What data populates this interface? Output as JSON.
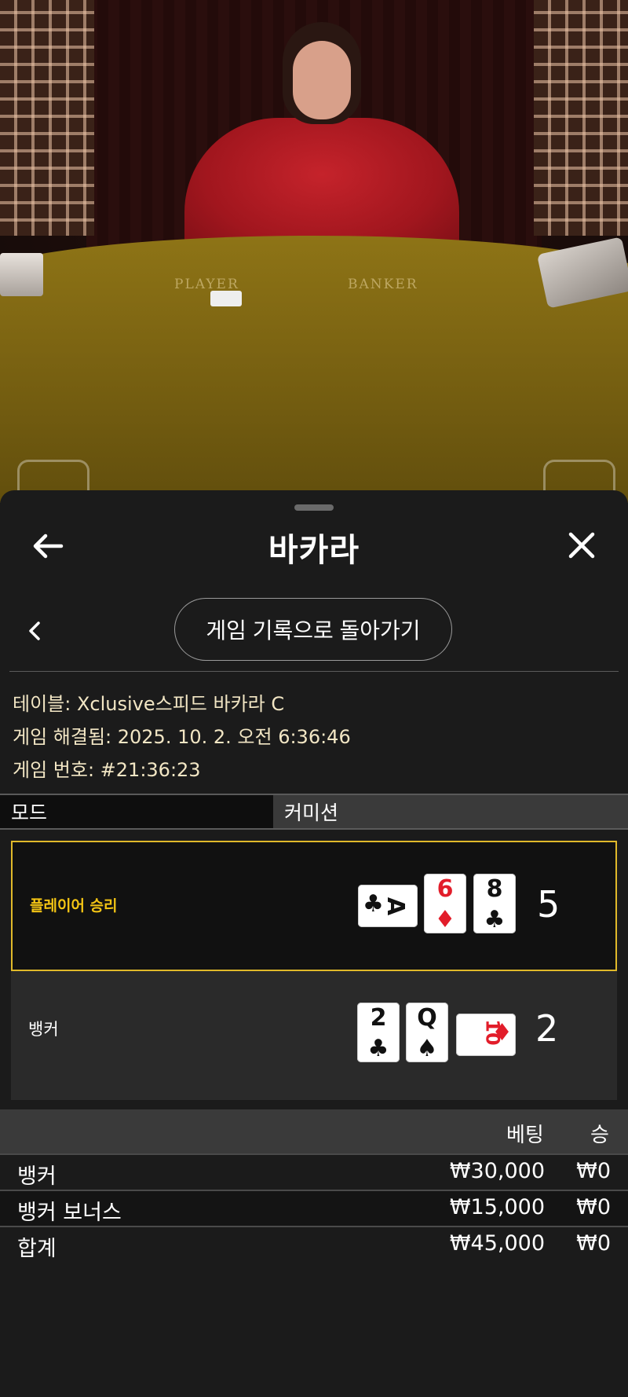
{
  "video": {
    "felt_player": "PLAYER",
    "felt_banker": "BANKER"
  },
  "header": {
    "title": "바카라",
    "back_icon": "arrow-left-icon",
    "close_icon": "close-icon"
  },
  "nav": {
    "history_button": "게임 기록으로 돌아가기",
    "chevron_icon": "chevron-left-icon"
  },
  "info": {
    "table_label": "테이블: ",
    "table_value": "Xclusive스피드 바카라 C",
    "resolved_label": "게임 해결됨: ",
    "resolved_value": "2025. 10. 2. 오전 6:36:46",
    "number_label": "게임 번호: ",
    "number_value": "#21:36:23"
  },
  "tabs": {
    "mode": "모드",
    "commission": "커미션"
  },
  "results": {
    "player": {
      "label": "플레이어 승리",
      "score": "5",
      "cards": [
        {
          "rank": "A",
          "suit": "♣",
          "color": "#111111",
          "orientation": "sideways"
        },
        {
          "rank": "6",
          "suit": "♦",
          "color": "#e21d2a",
          "orientation": "upright"
        },
        {
          "rank": "8",
          "suit": "♣",
          "color": "#111111",
          "orientation": "upright"
        }
      ]
    },
    "banker": {
      "label": "뱅커",
      "score": "2",
      "cards": [
        {
          "rank": "2",
          "suit": "♣",
          "color": "#111111",
          "orientation": "upright"
        },
        {
          "rank": "Q",
          "suit": "♠",
          "color": "#111111",
          "orientation": "upright"
        },
        {
          "rank": "10",
          "suit": "♦",
          "color": "#e21d2a",
          "orientation": "sideways"
        }
      ]
    }
  },
  "bets": {
    "header_bet": "베팅",
    "header_win": "승",
    "rows": [
      {
        "name": "뱅커",
        "bet": "₩30,000",
        "win": "₩0"
      },
      {
        "name": "뱅커 보너스",
        "bet": "₩15,000",
        "win": "₩0"
      },
      {
        "name": "합계",
        "bet": "₩45,000",
        "win": "₩0"
      }
    ]
  },
  "colors": {
    "accent_gold": "#f4c514",
    "winner_border": "#e0b92a",
    "sheet_bg": "#1b1b1b"
  }
}
